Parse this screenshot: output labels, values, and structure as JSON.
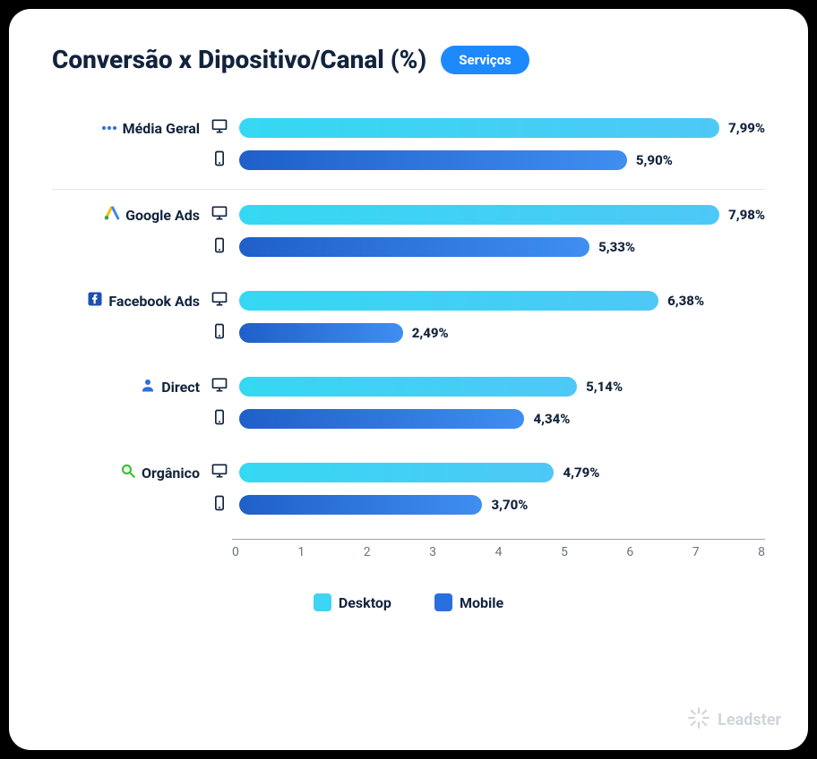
{
  "title": "Conversão x Dipositivo/Canal (%)",
  "badge": "Serviços",
  "legend": {
    "desktop": "Desktop",
    "mobile": "Mobile"
  },
  "xaxis": {
    "min": 0,
    "max": 8,
    "ticks": [
      "0",
      "1",
      "2",
      "3",
      "4",
      "5",
      "6",
      "7",
      "8"
    ]
  },
  "brand": "Leadster",
  "channels": [
    {
      "name": "Média Geral",
      "desktop_label": "7,99%",
      "mobile_label": "5,90%",
      "desktop": 7.99,
      "mobile": 5.9,
      "separator": true
    },
    {
      "name": "Google Ads",
      "desktop_label": "7,98%",
      "mobile_label": "5,33%",
      "desktop": 7.98,
      "mobile": 5.33
    },
    {
      "name": "Facebook Ads",
      "desktop_label": "6,38%",
      "mobile_label": "2,49%",
      "desktop": 6.38,
      "mobile": 2.49
    },
    {
      "name": "Direct",
      "desktop_label": "5,14%",
      "mobile_label": "4,34%",
      "desktop": 5.14,
      "mobile": 4.34
    },
    {
      "name": "Orgânico",
      "desktop_label": "4,79%",
      "mobile_label": "3,70%",
      "desktop": 4.79,
      "mobile": 3.7
    }
  ],
  "chart_data": {
    "type": "bar",
    "orientation": "horizontal",
    "grouped": true,
    "title": "Conversão x Dipositivo/Canal (%)",
    "xlabel": "",
    "ylabel": "",
    "xlim": [
      0,
      8
    ],
    "categories": [
      "Média Geral",
      "Google Ads",
      "Facebook Ads",
      "Direct",
      "Orgânico"
    ],
    "series": [
      {
        "name": "Desktop",
        "values": [
          7.99,
          7.98,
          6.38,
          5.14,
          4.79
        ],
        "color": "#40d4f4"
      },
      {
        "name": "Mobile",
        "values": [
          5.9,
          5.33,
          2.49,
          4.34,
          3.7
        ],
        "color": "#2a6fe0"
      }
    ],
    "legend_position": "bottom",
    "grid": false,
    "annotations": [
      {
        "category": "Média Geral",
        "series": "Desktop",
        "label": "7,99%"
      },
      {
        "category": "Média Geral",
        "series": "Mobile",
        "label": "5,90%"
      },
      {
        "category": "Google Ads",
        "series": "Desktop",
        "label": "7,98%"
      },
      {
        "category": "Google Ads",
        "series": "Mobile",
        "label": "5,33%"
      },
      {
        "category": "Facebook Ads",
        "series": "Desktop",
        "label": "6,38%"
      },
      {
        "category": "Facebook Ads",
        "series": "Mobile",
        "label": "2,49%"
      },
      {
        "category": "Direct",
        "series": "Desktop",
        "label": "5,14%"
      },
      {
        "category": "Direct",
        "series": "Mobile",
        "label": "4,34%"
      },
      {
        "category": "Orgânico",
        "series": "Desktop",
        "label": "4,79%"
      },
      {
        "category": "Orgânico",
        "series": "Mobile",
        "label": "3,70%"
      }
    ]
  }
}
